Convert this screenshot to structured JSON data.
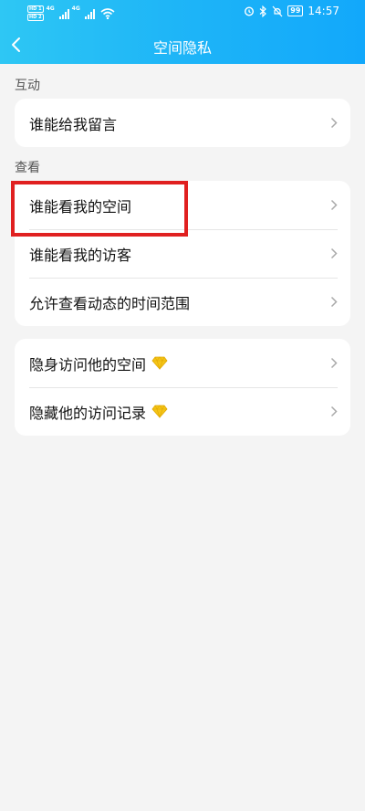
{
  "status_bar": {
    "hd1": "HD 1",
    "hd2": "HD 2",
    "net1": "4G",
    "net2": "4G",
    "battery": "99",
    "time": "14:57"
  },
  "header": {
    "title": "空间隐私"
  },
  "sections": {
    "interact": {
      "label": "互动",
      "items": [
        {
          "label": "谁能给我留言"
        }
      ]
    },
    "view": {
      "label": "查看",
      "items": [
        {
          "label": "谁能看我的空间"
        },
        {
          "label": "谁能看我的访客"
        },
        {
          "label": "允许查看动态的时间范围"
        }
      ]
    },
    "vip": {
      "items": [
        {
          "label": "隐身访问他的空间",
          "badge_icon": "diamond-icon"
        },
        {
          "label": "隐藏他的访问记录",
          "badge_icon": "diamond-icon"
        }
      ]
    }
  },
  "colors": {
    "header_gradient_start": "#2ec7f4",
    "header_gradient_end": "#12a8fb",
    "highlight": "#e02020",
    "diamond": "#f5c518",
    "background": "#f4f4f4"
  }
}
